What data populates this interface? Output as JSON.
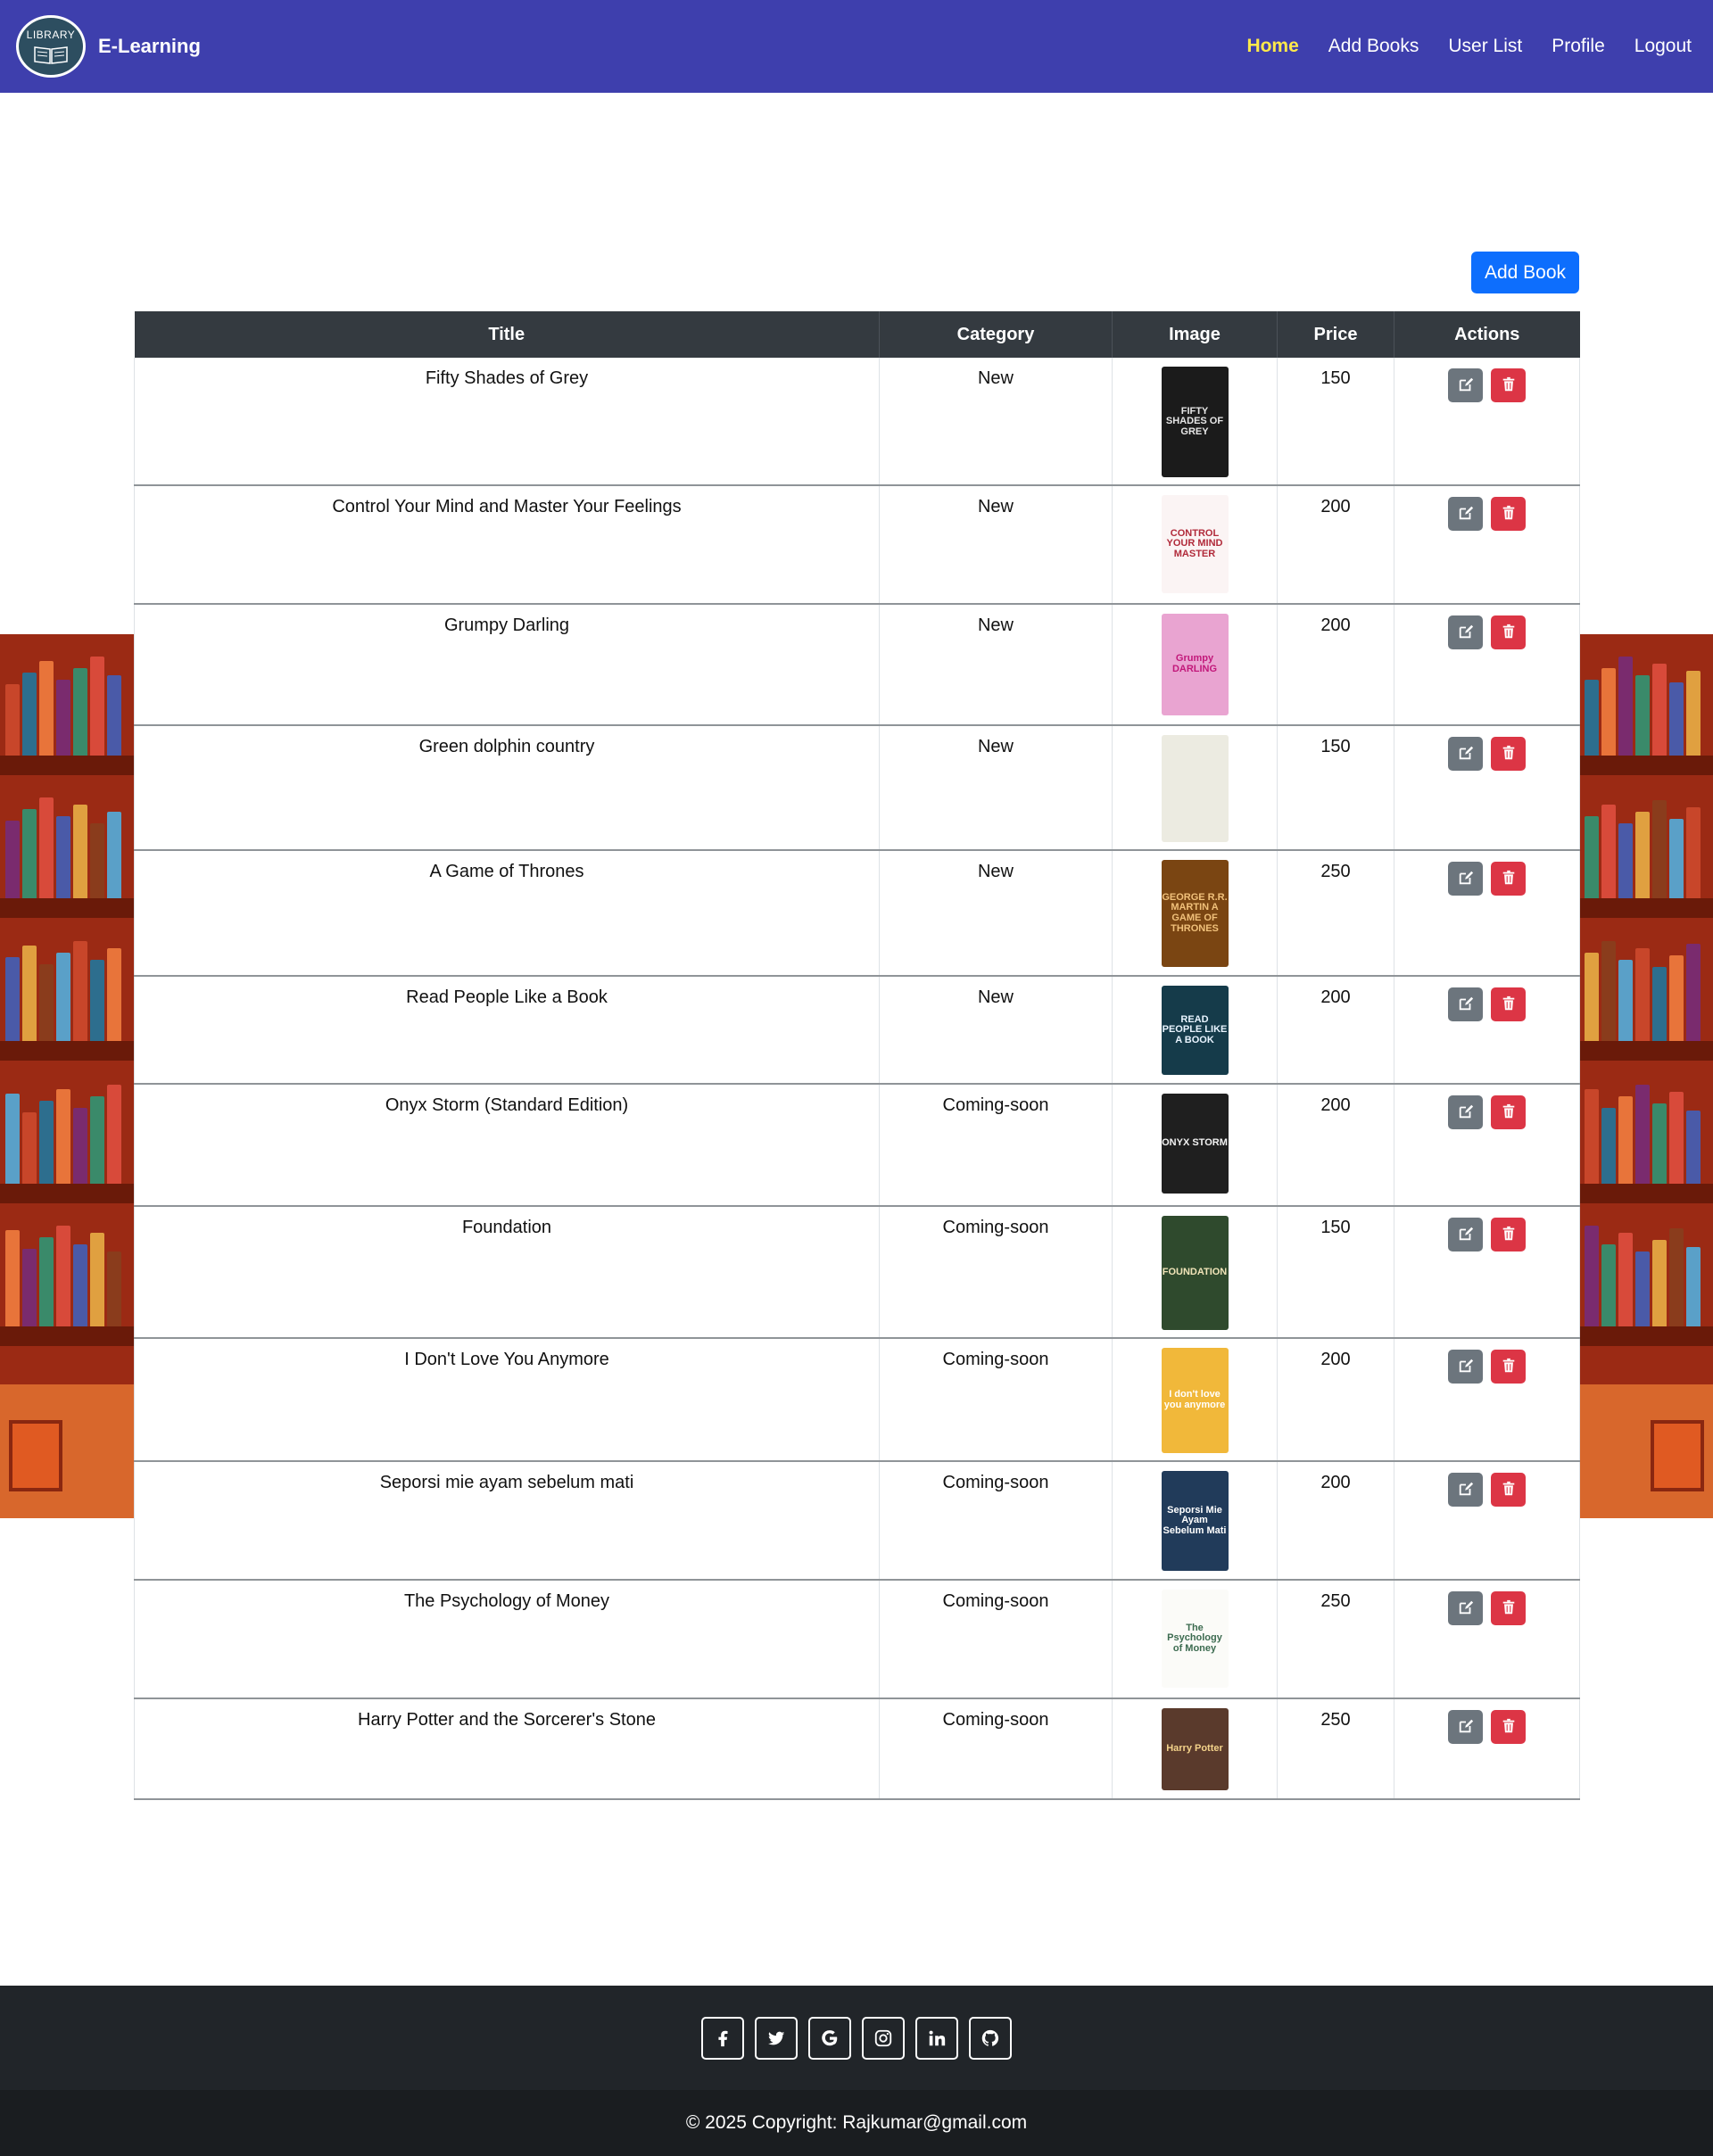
{
  "navbar": {
    "logo_text": "LIBRARY",
    "brand": "E-Learning",
    "links": [
      "Home",
      "Add Books",
      "User List",
      "Profile",
      "Logout"
    ],
    "active_link": "Home",
    "background_color": "#3e3fad",
    "active_color": "#ffe94a"
  },
  "toolbar": {
    "add_book_label": "Add Book",
    "add_book_color": "#0d6efd"
  },
  "table": {
    "columns": [
      "Title",
      "Category",
      "Image",
      "Price",
      "Actions"
    ],
    "rows": [
      {
        "title": "Fifty Shades of Grey",
        "category": "New",
        "price": "150"
      },
      {
        "title": "Control Your Mind and Master Your Feelings",
        "category": "New",
        "price": "200"
      },
      {
        "title": "Grumpy Darling",
        "category": "New",
        "price": "200"
      },
      {
        "title": "Green dolphin country",
        "category": "New",
        "price": "150"
      },
      {
        "title": "A Game of Thrones",
        "category": "New",
        "price": "250"
      },
      {
        "title": "Read People Like a Book",
        "category": "New",
        "price": "200"
      },
      {
        "title": "Onyx Storm (Standard Edition)",
        "category": "Coming-soon",
        "price": "200"
      },
      {
        "title": "Foundation",
        "category": "Coming-soon",
        "price": "150"
      },
      {
        "title": "I Don't Love You Anymore",
        "category": "Coming-soon",
        "price": "200"
      },
      {
        "title": "Seporsi mie ayam sebelum mati",
        "category": "Coming-soon",
        "price": "200"
      },
      {
        "title": "The Psychology of Money",
        "category": "Coming-soon",
        "price": "250"
      },
      {
        "title": "Harry Potter and the Sorcerer's Stone",
        "category": "Coming-soon",
        "price": "250"
      }
    ],
    "covers": [
      {
        "text": "FIFTY SHADES OF GREY",
        "bg": "#1b1b1b",
        "fg": "#e6e6e6"
      },
      {
        "text": "CONTROL YOUR MIND MASTER",
        "bg": "#fbf4f4",
        "fg": "#b12a3a"
      },
      {
        "text": "Grumpy DARLING",
        "bg": "#e9a4d1",
        "fg": "#c2187a"
      },
      {
        "text": "",
        "bg": "#ecebe1",
        "fg": "#8d8b80"
      },
      {
        "text": "GEORGE R.R. MARTIN A GAME OF THRONES",
        "bg": "#7a4512",
        "fg": "#f0c07a"
      },
      {
        "text": "READ PEOPLE LIKE A BOOK",
        "bg": "#153b4a",
        "fg": "#e8f4ff"
      },
      {
        "text": "ONYX STORM",
        "bg": "#1f1f1f",
        "fg": "#f2f2f2"
      },
      {
        "text": "FOUNDATION",
        "bg": "#2f4a2d",
        "fg": "#f0e4b8"
      },
      {
        "text": "I don't love you anymore",
        "bg": "#f1b83a",
        "fg": "#ffffff"
      },
      {
        "text": "Seporsi Mie Ayam Sebelum Mati",
        "bg": "#213b5a",
        "fg": "#ffffff"
      },
      {
        "text": "The Psychology of Money",
        "bg": "#fbfbf8",
        "fg": "#3c6b50"
      },
      {
        "text": "Harry Potter",
        "bg": "#5a3a2c",
        "fg": "#f3d28a"
      }
    ],
    "edit_color": "#6c757d",
    "delete_color": "#dc3545"
  },
  "footer": {
    "social_icons": [
      "facebook-icon",
      "twitter-icon",
      "google-icon",
      "instagram-icon",
      "linkedin-icon",
      "github-icon"
    ],
    "copyright": "© 2025 Copyright: Rajkumar@gmail.com"
  }
}
